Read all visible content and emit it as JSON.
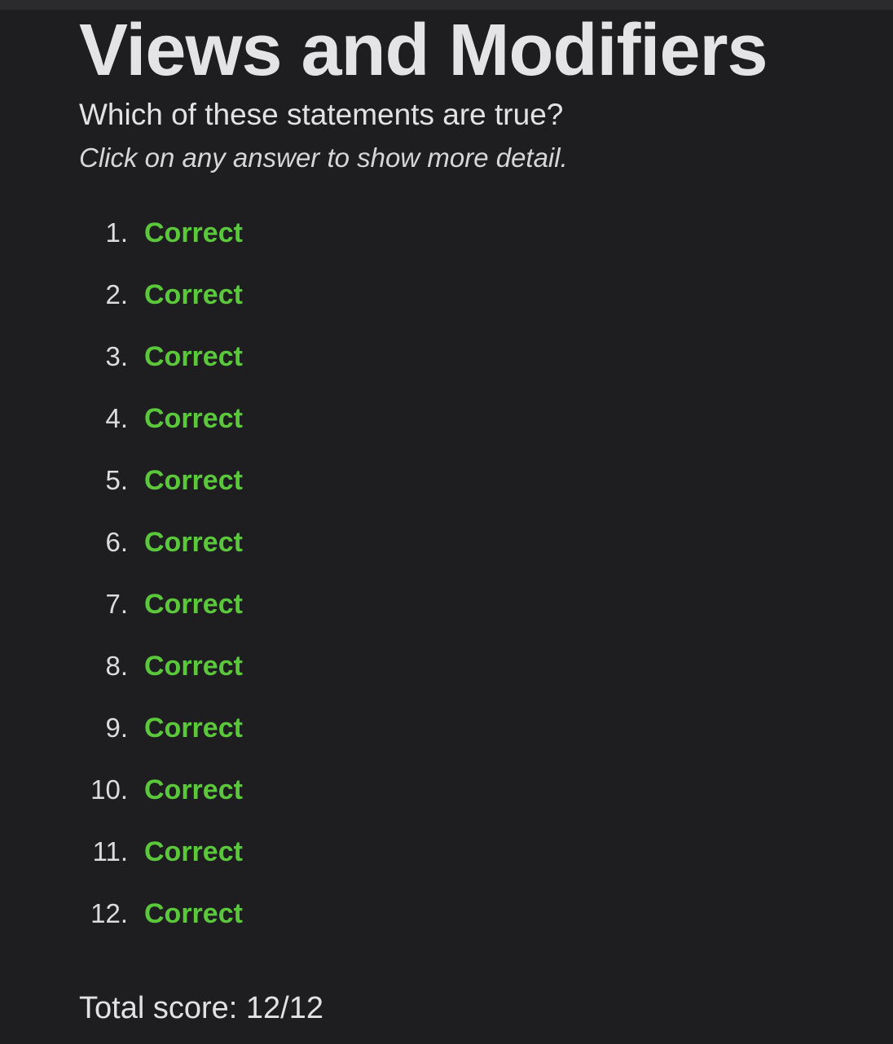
{
  "page": {
    "title": "Views and Modifiers",
    "question": "Which of these statements are true?",
    "instruction": "Click on any answer to show more detail."
  },
  "answers": [
    {
      "number": "1.",
      "result": "Correct"
    },
    {
      "number": "2.",
      "result": "Correct"
    },
    {
      "number": "3.",
      "result": "Correct"
    },
    {
      "number": "4.",
      "result": "Correct"
    },
    {
      "number": "5.",
      "result": "Correct"
    },
    {
      "number": "6.",
      "result": "Correct"
    },
    {
      "number": "7.",
      "result": "Correct"
    },
    {
      "number": "8.",
      "result": "Correct"
    },
    {
      "number": "9.",
      "result": "Correct"
    },
    {
      "number": "10.",
      "result": "Correct"
    },
    {
      "number": "11.",
      "result": "Correct"
    },
    {
      "number": "12.",
      "result": "Correct"
    }
  ],
  "score": {
    "text": "Total score: 12/12"
  },
  "colors": {
    "background": "#1e1e20",
    "text": "#e2e2e4",
    "correct": "#5bc83c"
  }
}
